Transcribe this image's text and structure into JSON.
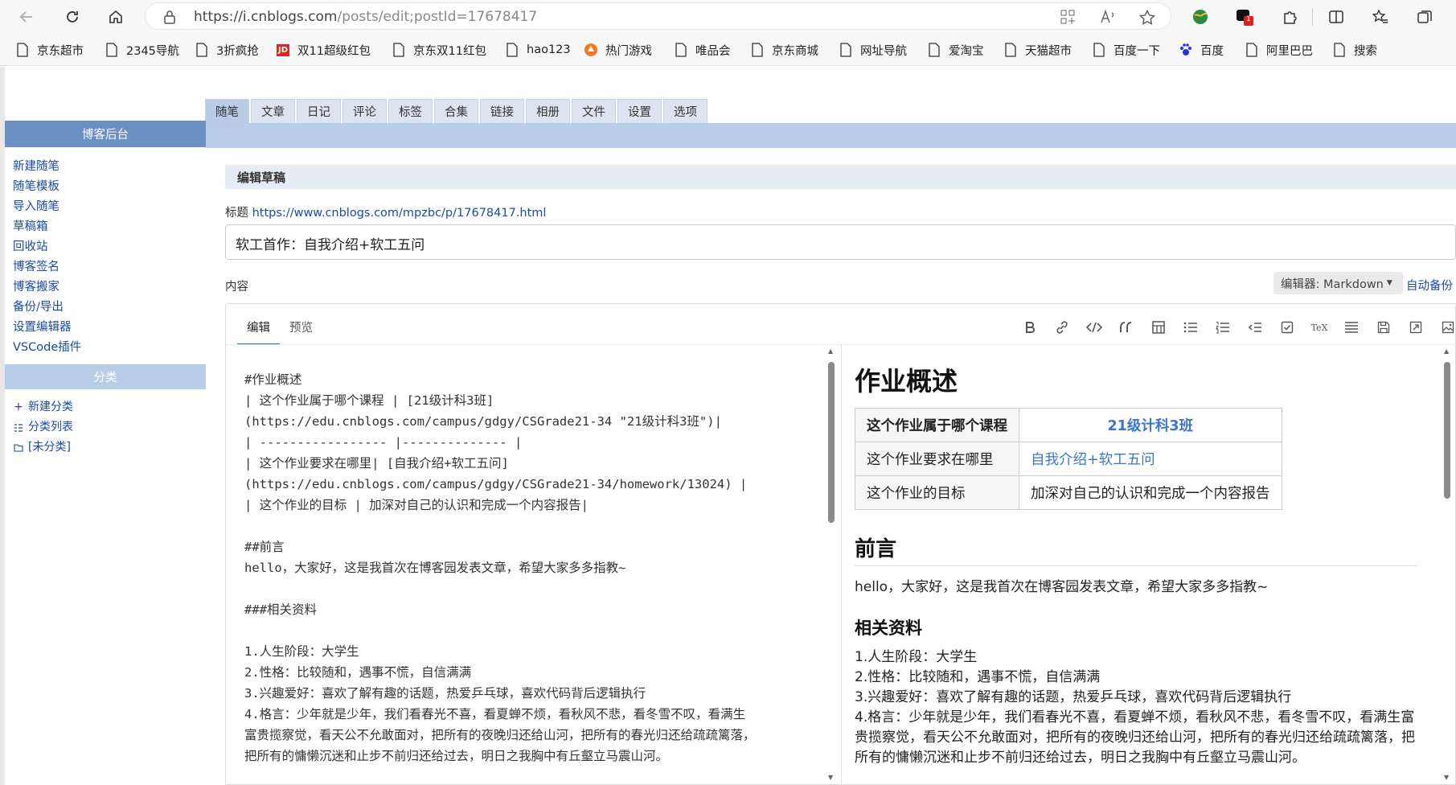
{
  "browser": {
    "url_host": "https://i.cnblogs.com",
    "url_path": "/posts/edit;postId=17678417",
    "notification_count": "1"
  },
  "bookmarks": [
    {
      "label": "京东超市",
      "icon": "page-icon"
    },
    {
      "label": "2345导航",
      "icon": "page-icon"
    },
    {
      "label": "3折疯抢",
      "icon": "page-icon"
    },
    {
      "label": "双11超级红包",
      "icon": "jd-logo-icon"
    },
    {
      "label": "京东双11红包",
      "icon": "page-icon"
    },
    {
      "label": "hao123",
      "icon": "page-icon"
    },
    {
      "label": "热门游戏",
      "icon": "game-icon"
    },
    {
      "label": "唯品会",
      "icon": "page-icon"
    },
    {
      "label": "京东商城",
      "icon": "page-icon"
    },
    {
      "label": "网址导航",
      "icon": "page-icon"
    },
    {
      "label": "爱淘宝",
      "icon": "page-icon"
    },
    {
      "label": "天猫超市",
      "icon": "page-icon"
    },
    {
      "label": "百度一下",
      "icon": "page-icon"
    },
    {
      "label": "百度",
      "icon": "baidu-paw-icon"
    },
    {
      "label": "阿里巴巴",
      "icon": "page-icon"
    },
    {
      "label": "搜索",
      "icon": "page-icon"
    }
  ],
  "tabs": [
    "随笔",
    "文章",
    "日记",
    "评论",
    "标签",
    "合集",
    "链接",
    "相册",
    "文件",
    "设置",
    "选项"
  ],
  "sidebar": {
    "title": "博客后台",
    "links": [
      "新建随笔",
      "随笔模板",
      "导入随笔",
      "草稿箱",
      "回收站",
      "博客签名",
      "博客搬家",
      "备份/导出",
      "设置编辑器",
      "VSCode插件"
    ],
    "category_title": "分类",
    "category_links": [
      "新建分类",
      "分类列表",
      "[未分类]"
    ]
  },
  "form": {
    "section_title": "编辑草稿",
    "title_label": "标题",
    "title_url": "https://www.cnblogs.com/mpzbc/p/17678417.html",
    "title_value": "软工首作：自我介绍+软工五问",
    "content_label": "内容",
    "editor_select": "编辑器: Markdown",
    "autosave": "自动备份"
  },
  "editor": {
    "tab_edit": "编辑",
    "tab_preview": "预览",
    "toolbar": [
      "bold-icon",
      "link-icon",
      "code-icon",
      "quote-icon",
      "table-icon",
      "bullet-list-icon",
      "ordered-list-icon",
      "indent-icon",
      "checkbox-icon",
      "tex-icon",
      "align-icon",
      "save-icon",
      "fullscreen-icon",
      "image-icon"
    ],
    "source": "#作业概述\n| 这个作业属于哪个课程 | [21级计科3班]\n(https://edu.cnblogs.com/campus/gdgy/CSGrade21-34 \"21级计科3班\")|\n| ----------------- |-------------- |\n| 这个作业要求在哪里| [自我介绍+软工五问]\n(https://edu.cnblogs.com/campus/gdgy/CSGrade21-34/homework/13024) |\n| 这个作业的目标 | 加深对自己的认识和完成一个内容报告|\n\n##前言\nhello，大家好，这是我首次在博客园发表文章，希望大家多多指教~\n\n###相关资料\n\n1.人生阶段：大学生\n2.性格：比较随和，遇事不慌，自信满满\n3.兴趣爱好：喜欢了解有趣的话题，热爱乒乓球，喜欢代码背后逻辑执行\n4.格言：少年就是少年，我们看春光不喜，看夏蝉不烦，看秋风不悲，看冬雪不叹，看满生\n富贵揽察觉，看天公不允敢面对，把所有的夜晚归还给山河，把所有的春光归还给疏疏篱落，\n把所有的慵懒沉迷和止步不前归还给过去，明日之我胸中有丘壑立马震山河。"
  },
  "preview": {
    "h1": "作业概述",
    "table": [
      [
        "这个作业属于哪个课程",
        "21级计科3班"
      ],
      [
        "这个作业要求在哪里",
        "自我介绍+软工五问"
      ],
      [
        "这个作业的目标",
        "加深对自己的认识和完成一个内容报告"
      ]
    ],
    "h2": "前言",
    "intro": "hello，大家好，这是我首次在博客园发表文章，希望大家多多指教~",
    "h3": "相关资料",
    "items": [
      "1.人生阶段：大学生",
      "2.性格：比较随和，遇事不慌，自信满满",
      "3.兴趣爱好：喜欢了解有趣的话题，热爱乒乓球，喜欢代码背后逻辑执行",
      "4.格言：少年就是少年，我们看春光不喜，看夏蝉不烦，看秋风不悲，看冬雪不叹，看满生富贵揽察觉，看天公不允敢面对，把所有的夜晚归还给山河，把所有的春光归还给疏疏篱落，把所有的慵懒沉迷和止步不前归还给过去，明日之我胸中有丘壑立马震山河。"
    ]
  }
}
